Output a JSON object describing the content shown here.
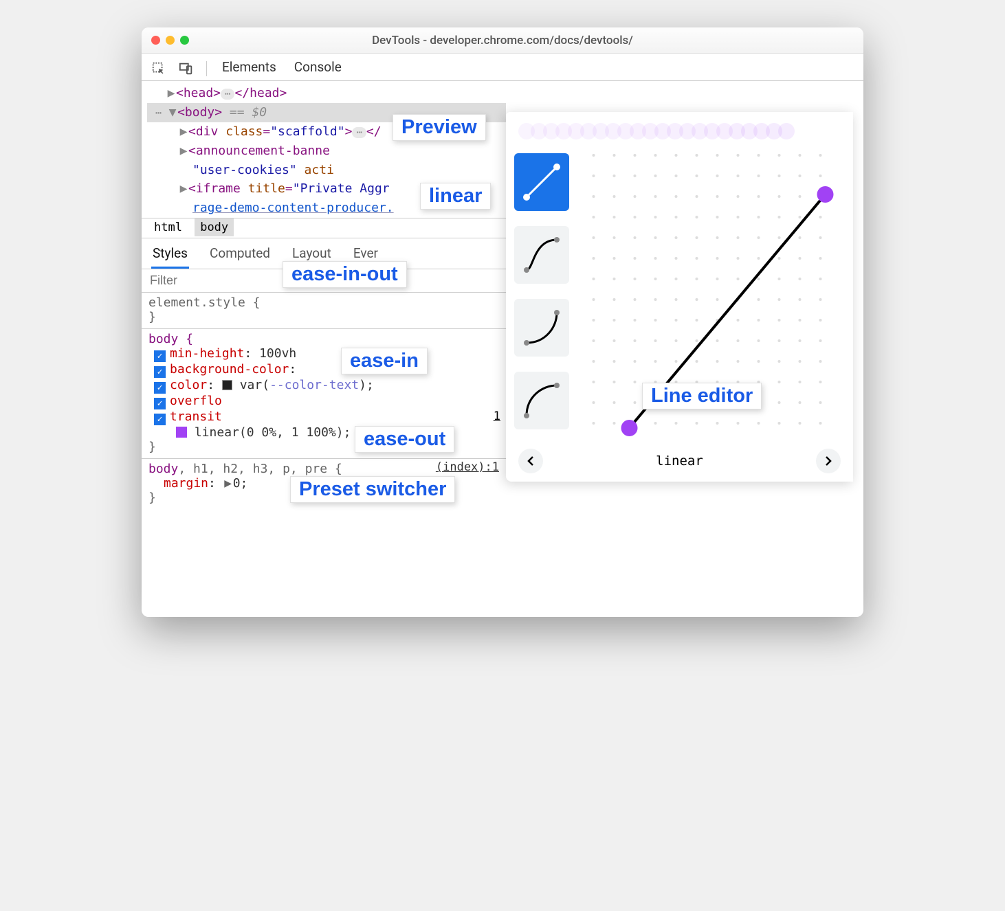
{
  "window_title": "DevTools - developer.chrome.com/docs/devtools/",
  "tabs": {
    "elements": "Elements",
    "console": "Console"
  },
  "dom": {
    "head": "<head>",
    "head_close": "</head>",
    "body": "<body>",
    "body_eq": " == $0",
    "div_open": "<div ",
    "div_attr_n": "class",
    "div_attr_v": "\"scaffold\"",
    "ann_open": "<announcement-banne",
    "ann_attr_v": "\"user-cookies\"",
    "ann_attr2": " acti",
    "iframe_open": "<iframe ",
    "iframe_attr_n": "title",
    "iframe_attr_v": "\"Private Aggr",
    "iframe_link": "rage-demo-content-producer."
  },
  "crumbs": {
    "a": "html",
    "b": "body"
  },
  "subtabs": {
    "styles": "Styles",
    "computed": "Computed",
    "layout": "Layout",
    "event": "Ever"
  },
  "filter_placeholder": "Filter",
  "rules": {
    "es_selector": "element.style {",
    "body_selector": "body {",
    "p1_n": "min-height",
    "p1_v": "100vh",
    "p2_n": "background-color",
    "p3_n": "color",
    "p3_v": "var(",
    "p3_var": "--color-text",
    "p3_close": ");",
    "p4_n": "overflo",
    "p5_n": "transit",
    "p5_v": "linear(0 0%, 1 100%);",
    "close": "}",
    "r3_sel": "body, h1, h2, h3, p, pre {",
    "r3_p": "margin",
    "r3_v": "0;",
    "r3_src": "(index):1"
  },
  "editor": {
    "presets": [
      "linear",
      "ease-in-out",
      "ease-in",
      "ease-out"
    ],
    "current_name": "linear"
  },
  "annotations": {
    "preview": "Preview",
    "linear": "linear",
    "ease_in_out": "ease-in-out",
    "ease_in": "ease-in",
    "ease_out": "ease-out",
    "preset_switcher": "Preset switcher",
    "line_editor": "Line editor"
  },
  "src_right": "1"
}
